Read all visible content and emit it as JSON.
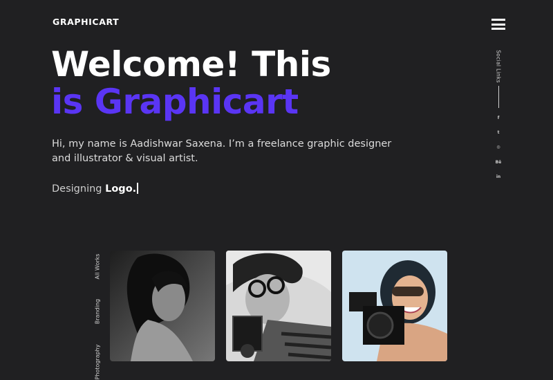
{
  "header": {
    "logo": "GRAPHICART",
    "menu_icon": "hamburger-menu-icon"
  },
  "hero": {
    "line1": "Welcome! This",
    "line2": "is Graphicart",
    "accent_color": "#5a35f4"
  },
  "intro": {
    "text": "Hi, my name is Aadishwar Saxena. I’m a freelance graphic designer and illustrator & visual artist."
  },
  "typing": {
    "prefix": "Designing",
    "word": "Logo."
  },
  "social": {
    "label": "Social Links",
    "icons": [
      {
        "name": "facebook-icon",
        "glyph": "f"
      },
      {
        "name": "twitter-icon",
        "glyph": "t"
      },
      {
        "name": "instagram-icon",
        "glyph": "◎"
      },
      {
        "name": "behance-icon",
        "glyph": "Bē"
      },
      {
        "name": "linkedin-icon",
        "glyph": "in"
      }
    ]
  },
  "portfolio": {
    "categories": [
      "All Works",
      "Branding",
      "Photography"
    ],
    "cards": [
      {
        "alt": "Black and white portrait of a woman"
      },
      {
        "alt": "Woman with glasses holding a vintage camera"
      },
      {
        "alt": "Smiling woman with sunglasses holding a DSLR camera"
      }
    ]
  },
  "colors": {
    "background": "#202022",
    "accent": "#5a35f4",
    "text": "#ffffff"
  }
}
